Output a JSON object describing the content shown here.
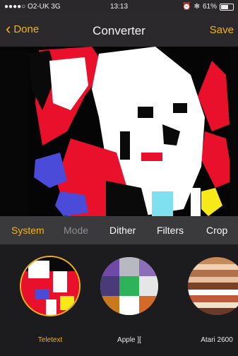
{
  "status_bar": {
    "carrier": "●●●●○ O2-UK  3G",
    "time": "13:13",
    "battery": "61%"
  },
  "nav": {
    "back_label": "Done",
    "title": "Converter",
    "save_label": "Save"
  },
  "tabs": [
    {
      "label": "System",
      "active": true
    },
    {
      "label": "Mode",
      "active": false,
      "dim": true
    },
    {
      "label": "Dither",
      "active": false
    },
    {
      "label": "Filters",
      "active": false
    },
    {
      "label": "Crop",
      "active": false
    }
  ],
  "systems": [
    {
      "label": "Teletext",
      "selected": true
    },
    {
      "label": "Apple ][",
      "selected": false
    },
    {
      "label": "Atari 2600",
      "selected": false
    }
  ],
  "colors": {
    "accent": "#f2b318",
    "teletext_red": "#e8102a",
    "teletext_blue": "#4b4bd9",
    "teletext_yellow": "#f7e81a",
    "teletext_cyan": "#7fe0f0"
  }
}
